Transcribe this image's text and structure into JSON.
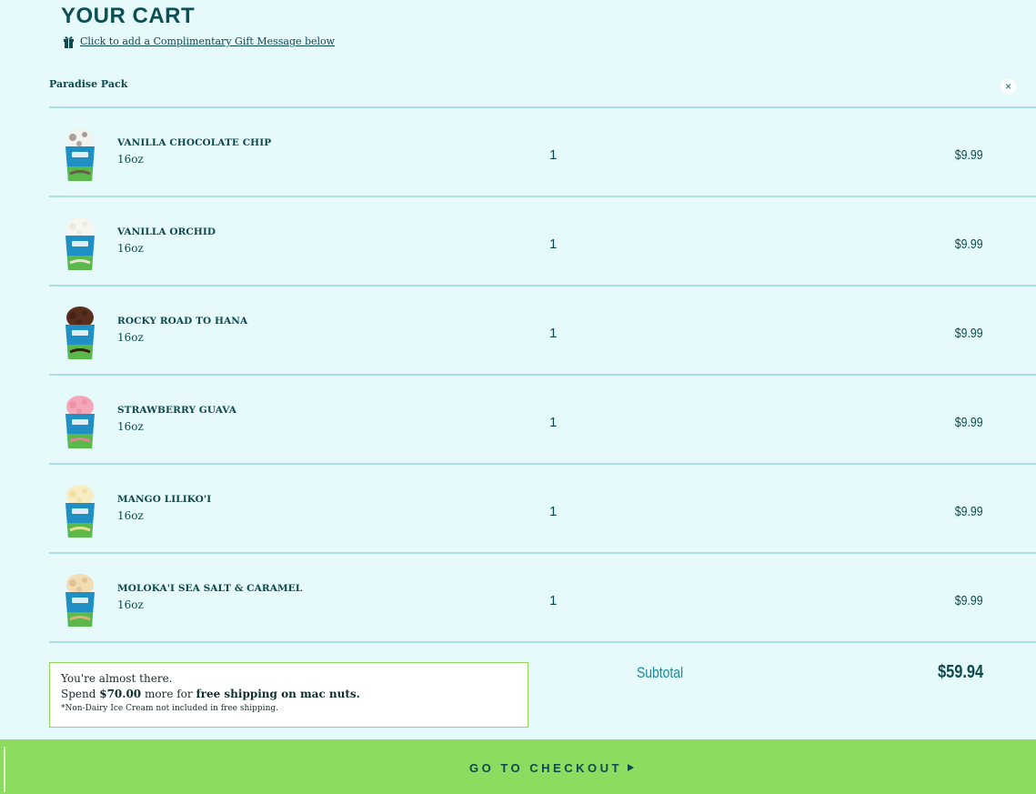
{
  "cart": {
    "title": "YOUR CART",
    "gift_link": "Click to add a Complimentary Gift Message below",
    "pack_title": "Paradise Pack",
    "remove_label": "×"
  },
  "items": [
    {
      "name": "VANILLA CHOCOLATE CHIP",
      "size": "16oz",
      "qty": "1",
      "price": "$9.99",
      "scoop_color": "#f1f3f0",
      "accent": "#6b5a4e"
    },
    {
      "name": "VANILLA ORCHID",
      "size": "16oz",
      "qty": "1",
      "price": "$9.99",
      "scoop_color": "#f7f6f0",
      "accent": "#e6e2d6"
    },
    {
      "name": "ROCKY ROAD TO HANA",
      "size": "16oz",
      "qty": "1",
      "price": "$9.99",
      "scoop_color": "#5a2e1e",
      "accent": "#3b1d12"
    },
    {
      "name": "STRAWBERRY GUAVA",
      "size": "16oz",
      "qty": "1",
      "price": "$9.99",
      "scoop_color": "#f4a7b9",
      "accent": "#e77f99"
    },
    {
      "name": "MANGO LILIKO'I",
      "size": "16oz",
      "qty": "1",
      "price": "$9.99",
      "scoop_color": "#f7ecc4",
      "accent": "#f0d98a"
    },
    {
      "name": "MOLOKA'I SEA SALT & CARAMEL",
      "size": "16oz",
      "qty": "1",
      "price": "$9.99",
      "scoop_color": "#f2dcb4",
      "accent": "#d6b17a"
    }
  ],
  "shipping": {
    "line1": "You're almost there.",
    "prefix": "Spend ",
    "amount": "$70.00",
    "middle": " more for ",
    "bold_text": "free shipping on mac nuts.",
    "note": "*Non-Dairy Ice Cream not included in free shipping."
  },
  "summary": {
    "subtotal_label": "Subtotal",
    "subtotal_value": "$59.94"
  },
  "checkout": {
    "label": "GO TO CHECKOUT"
  },
  "colors": {
    "background": "#e6f9fb",
    "divider": "#a9dfe2",
    "checkout_bg": "#8ddb5f",
    "text_dark": "#0c4a4e",
    "subtotal_label": "#1a8a96",
    "pint_blue": "#1f8fc4",
    "pint_green": "#5bb84a"
  }
}
